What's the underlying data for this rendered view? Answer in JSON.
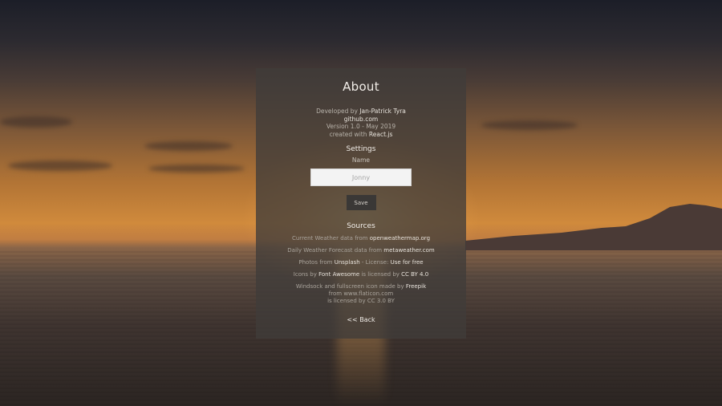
{
  "about": {
    "title": "About",
    "developed_prefix": "Developed by ",
    "developer": "Jan-Patrick Tyra",
    "github": "github.com",
    "version": "Version 1.0 - May 2019",
    "created_prefix": "created with ",
    "framework": "React.js"
  },
  "settings": {
    "title": "Settings",
    "name_label": "Name",
    "name_placeholder": "Jonny",
    "save_label": "Save"
  },
  "sources": {
    "title": "Sources",
    "current_weather_prefix": "Current Weather data from ",
    "current_weather_link": "openweathermap.org",
    "forecast_prefix": "Daily Weather Forecast data from ",
    "forecast_link": "metaweather.com",
    "photos_prefix": "Photos from ",
    "photos_link": "Unsplash",
    "photos_license_prefix": " - License: ",
    "photos_license_link": "Use for free",
    "icons_prefix": "Icons by ",
    "icons_link": "Font Awesome",
    "icons_license_prefix": " is licensed by ",
    "icons_license_link": "CC BY 4.0",
    "windsock_prefix": "Windsock and fullscreen icon made by ",
    "windsock_link": "Freepik",
    "windsock_from_prefix": "from ",
    "windsock_from_link": "www.flaticon.com",
    "windsock_license_prefix": "is licensed by ",
    "windsock_license_link": "CC 3.0 BY"
  },
  "back_label": "<< Back",
  "colors": {
    "panel_bg": "#403c3a",
    "text_light": "#f1ede8",
    "text_muted": "#aaa49c"
  }
}
